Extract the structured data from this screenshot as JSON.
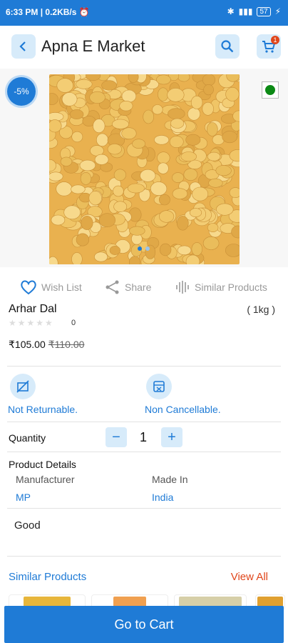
{
  "status": {
    "time": "6:33 PM",
    "speed": "0.2KB/s",
    "battery": "57"
  },
  "header": {
    "title": "Apna E Market",
    "cart_count": "1"
  },
  "product": {
    "discount_badge": "-5%",
    "name": "Arhar Dal",
    "size": "( 1kg )",
    "rating_count": "0",
    "price": "₹105.00",
    "old_price": "₹110.00",
    "description": "Good"
  },
  "actions": {
    "wishlist": "Wish List",
    "share": "Share",
    "similar": "Similar Products"
  },
  "features": {
    "not_returnable": "Not Returnable.",
    "non_cancellable": "Non Cancellable."
  },
  "quantity": {
    "label": "Quantity",
    "value": "1",
    "minus": "−",
    "plus": "+"
  },
  "details": {
    "title": "Product Details",
    "manufacturer_label": "Manufacturer",
    "manufacturer_value": "MP",
    "made_in_label": "Made In",
    "made_in_value": "India"
  },
  "similar": {
    "title": "Similar Products",
    "view_all": "View All"
  },
  "cta": {
    "go_to_cart": "Go to Cart"
  },
  "colors": {
    "primary": "#1f7bd6",
    "accent": "#e0461b",
    "light_blue": "#d7ebfa"
  }
}
